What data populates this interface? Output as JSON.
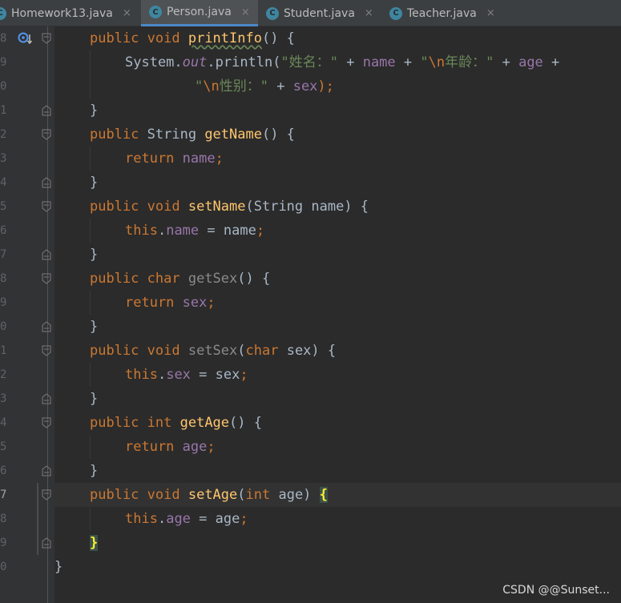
{
  "tabs": [
    {
      "label": "Homework13.java",
      "active": false
    },
    {
      "label": "Person.java",
      "active": true
    },
    {
      "label": "Student.java",
      "active": false
    },
    {
      "label": "Teacher.java",
      "active": false
    }
  ],
  "tab_close_glyph": "×",
  "file_icon_letter": "C",
  "line_numbers": [
    "8",
    "9",
    "0",
    "1",
    "2",
    "3",
    "4",
    "5",
    "6",
    "7",
    "8",
    "9",
    "0",
    "1",
    "2",
    "3",
    "4",
    "5",
    "6",
    "7",
    "8",
    "9",
    "0"
  ],
  "code": {
    "l1_kw": "public void",
    "l1_name": "printInfo",
    "l1_rest": "() {",
    "l2_a": "System.",
    "l2_out": "out",
    "l2_b": ".println(",
    "l2_s1": "\"姓名：\"",
    "l2_c": " + ",
    "l2_f1": "name",
    "l2_d": " + ",
    "l2_s2a": "\"",
    "l2_esc1": "\\n",
    "l2_s2b": "年龄：\"",
    "l2_e": " + ",
    "l2_f2": "age",
    "l2_g": " +",
    "l3_s3a": "\"",
    "l3_esc2": "\\n",
    "l3_s3b": "性别：\"",
    "l3_a": " + ",
    "l3_f": "sex",
    "l3_b": ");",
    "close_brace": "}",
    "l5_kw": "public",
    "l5_type": " String ",
    "l5_name": "getName",
    "l5_rest": "() {",
    "ret_kw": "return",
    "l6_f": "name",
    "semi": ";",
    "l8_kw": "public void",
    "l8_name": "setName",
    "l8_rest": "(String name) {",
    "this_kw": "this",
    "l9_f": "name",
    "l9_rest": " = name",
    "l11_kw": "public char",
    "l11_name": "getSex",
    "l11_rest": "() {",
    "l12_f": "sex",
    "l14_kw": "public void",
    "l14_name": "setSex",
    "l14_p1": "(",
    "l14_ptype": "char",
    "l14_p2": " sex) {",
    "l15_f": "sex",
    "l15_rest": " = sex",
    "l17_kw": "public int",
    "l17_name": "getAge",
    "l17_rest": "() {",
    "l18_f": "age",
    "l20_kw": "public void",
    "l20_name": "setAge",
    "l20_p1": "(",
    "l20_ptype": "int",
    "l20_p2": " age) ",
    "l20_brace": "{",
    "l21_f": "age",
    "l21_rest": " = age",
    "l22_brace": "}",
    "l23_brace": "}"
  },
  "watermark": "CSDN @@Sunset...",
  "colors": {
    "background": "#2b2b2b",
    "keyword": "#cc7832",
    "method": "#ffc66d",
    "field": "#9876aa",
    "string": "#6a8759",
    "default_text": "#a9b7c6",
    "active_tab_underline": "#4a88c7"
  },
  "icons": {
    "tab_file_icon": "java-class-icon",
    "gutter_override": "override-method-icon",
    "fold_marker": "fold-marker-icon"
  }
}
